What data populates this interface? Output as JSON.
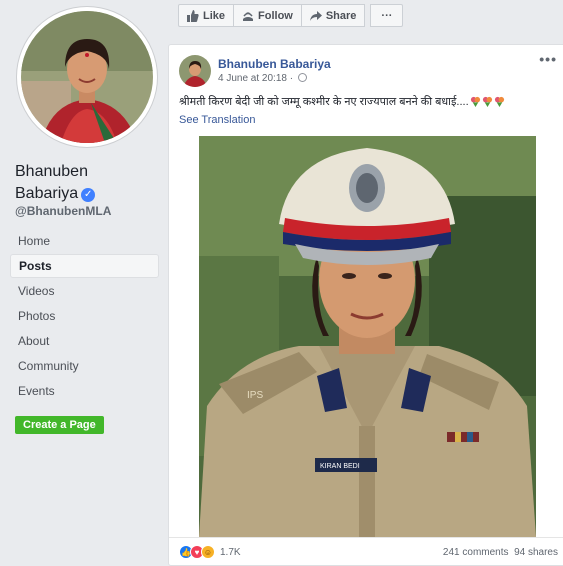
{
  "profile": {
    "name": "Bhanuben Babariya",
    "name_line1": "Bhanuben",
    "name_line2": "Babariya",
    "handle": "@BhanubenMLA",
    "verified": true
  },
  "nav": {
    "items": [
      {
        "label": "Home"
      },
      {
        "label": "Posts",
        "active": true
      },
      {
        "label": "Videos"
      },
      {
        "label": "Photos"
      },
      {
        "label": "About"
      },
      {
        "label": "Community"
      },
      {
        "label": "Events"
      }
    ],
    "create_page_label": "Create a Page"
  },
  "actions": {
    "like": "Like",
    "follow": "Follow",
    "share": "Share",
    "more": "···"
  },
  "post": {
    "author": "Bhanuben Babariya",
    "timestamp": "4 June at 20:18 · ",
    "text": "श्रीमती किरण बेदी जी को जम्मू कश्मीर के नए राज्यपाल बनने की बधाई....",
    "see_translation": "See Translation",
    "more_label": "•••",
    "reactions_count": "1.7K",
    "comments": "241 comments",
    "shares": "94 shares",
    "photo_badge": "KIRAN BEDI",
    "photo_epaulette": "IPS"
  },
  "colors": {
    "link": "#385898",
    "verified": "#4080ff",
    "create_button": "#42b72a",
    "like_reaction": "#1877f2",
    "love_reaction": "#f33e58",
    "haha_reaction": "#f7b125"
  }
}
